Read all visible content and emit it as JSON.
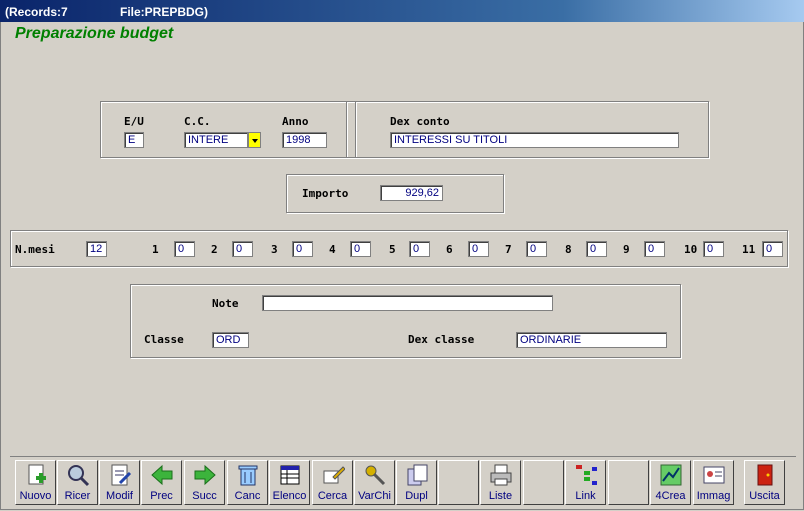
{
  "titlebar": {
    "records": "(Records:7",
    "file": "File:PREPBDG)"
  },
  "heading": "Preparazione budget",
  "row1": {
    "eu_label": "E/U",
    "eu_value": "E",
    "cc_label": "C.C.",
    "cc_value": "INTERE",
    "anno_label": "Anno",
    "anno_value": "1998",
    "dex_conto_label": "Dex conto",
    "dex_conto_value": "INTERESSI SU TITOLI"
  },
  "importo": {
    "label": "Importo",
    "value": "929,62"
  },
  "mesi": {
    "label": "N.mesi",
    "value": "12",
    "months": [
      {
        "n": "1",
        "v": "0"
      },
      {
        "n": "2",
        "v": "0"
      },
      {
        "n": "3",
        "v": "0"
      },
      {
        "n": "4",
        "v": "0"
      },
      {
        "n": "5",
        "v": "0"
      },
      {
        "n": "6",
        "v": "0"
      },
      {
        "n": "7",
        "v": "0"
      },
      {
        "n": "8",
        "v": "0"
      },
      {
        "n": "9",
        "v": "0"
      },
      {
        "n": "10",
        "v": "0"
      },
      {
        "n": "11",
        "v": "0"
      }
    ]
  },
  "note": {
    "label": "Note",
    "value": ""
  },
  "classe": {
    "label": "Classe",
    "value": "ORD",
    "dex_label": "Dex classe",
    "dex_value": "ORDINARIE"
  },
  "toolbar": {
    "buttons": [
      {
        "label": "Nuovo",
        "icon": "new-document-icon"
      },
      {
        "label": "Ricer",
        "icon": "magnifier-icon"
      },
      {
        "label": "Modif",
        "icon": "edit-document-icon"
      },
      {
        "label": "Prec",
        "icon": "arrow-left-icon"
      },
      {
        "label": "Succ",
        "icon": "arrow-right-icon"
      },
      {
        "label": "Canc",
        "icon": "trash-icon"
      },
      {
        "label": "Elenco",
        "icon": "list-table-icon"
      },
      {
        "label": "Cerca",
        "icon": "search-highlight-icon"
      },
      {
        "label": "VarChi",
        "icon": "keys-icon"
      },
      {
        "label": "Dupl",
        "icon": "duplicate-icon"
      },
      {
        "label": "",
        "icon": ""
      },
      {
        "label": "Liste",
        "icon": "printer-icon"
      },
      {
        "label": "",
        "icon": ""
      },
      {
        "label": "Link",
        "icon": "link-tree-icon"
      },
      {
        "label": "",
        "icon": ""
      },
      {
        "label": "4Crea",
        "icon": "create-chart-icon"
      },
      {
        "label": "Immag",
        "icon": "id-card-icon"
      },
      {
        "label": "",
        "icon": ""
      },
      {
        "label": "Uscita",
        "icon": "exit-door-icon"
      }
    ]
  },
  "colors": {
    "window_bg": "#d4d0c8",
    "heading": "#008000",
    "field_text": "#000080",
    "titlebar": "#0a246a"
  }
}
